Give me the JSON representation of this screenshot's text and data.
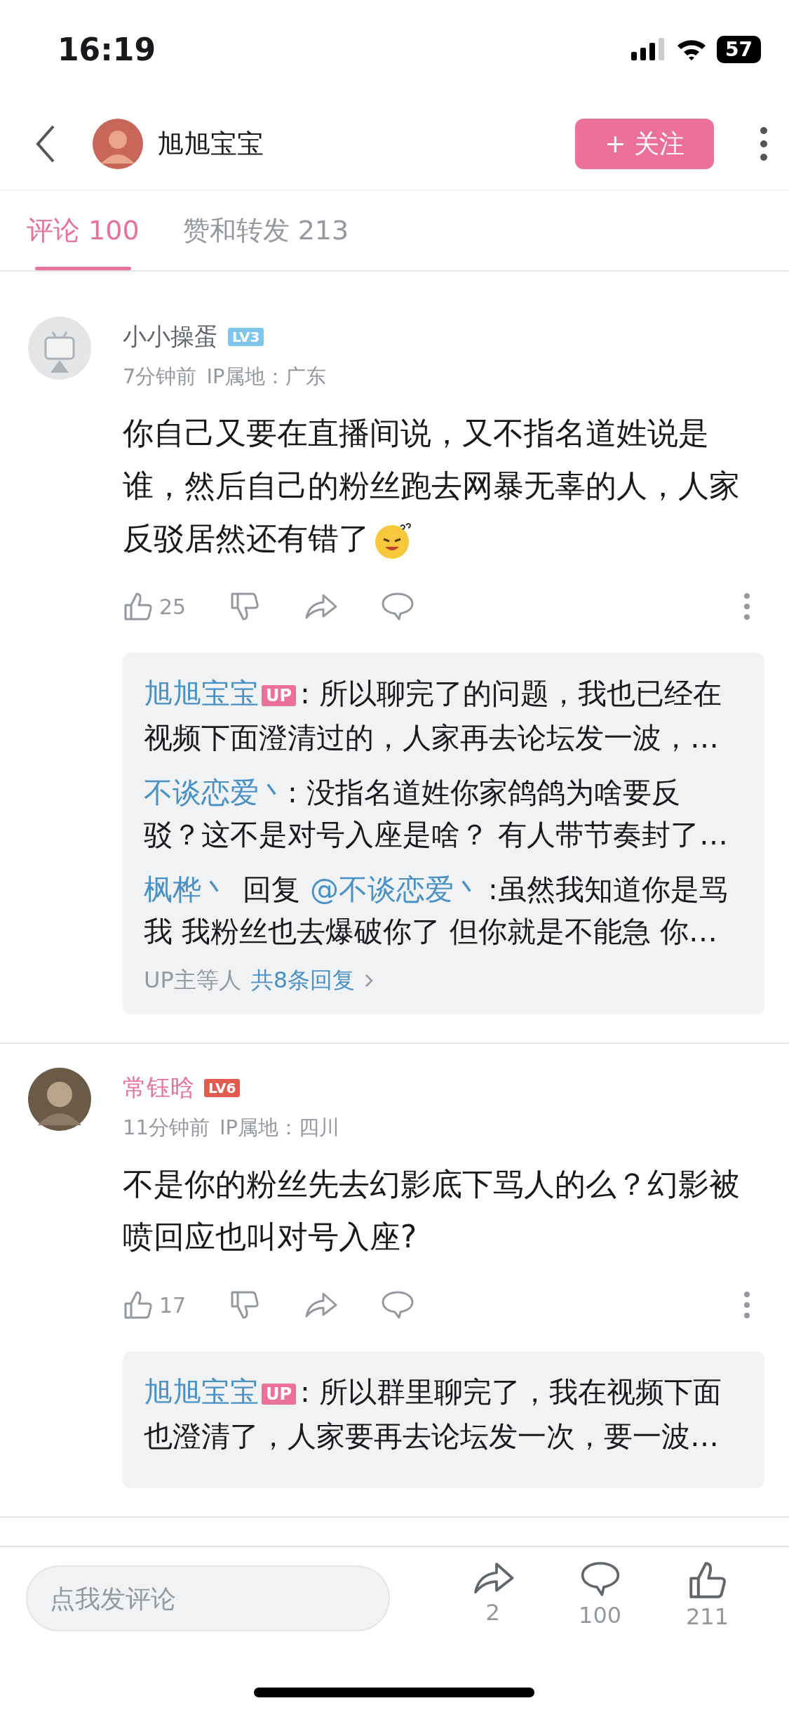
{
  "status_bar": {
    "time": "16:19",
    "battery": "57"
  },
  "header": {
    "user": "旭旭宝宝",
    "follow_button": "+ 关注"
  },
  "tabs": [
    {
      "label": "评论 100",
      "selected": true
    },
    {
      "label": "赞和转发 213",
      "selected": false
    }
  ],
  "comments": [
    {
      "user": "小小操蛋",
      "vip": false,
      "level": "LV3",
      "color": "#7fc6ec",
      "time": "7分钟前",
      "ip": "IP属地：广东",
      "body": "你自己又要在直播间说，又不指名道姓说是谁，然后自己的粉丝跑去网暴无辜的人，人家反驳居然还有错了",
      "emoji": true,
      "likes": "25",
      "replies": [
        {
          "author": "旭旭宝宝",
          "badge": "UP",
          "text": ": 所以聊完了的问题，我也已经在视频下面澄清过的，人家再去论坛发一波，…"
        },
        {
          "author": "不谈恋爱丶",
          "text": ": 没指名道姓你家鸽鸽为啥要反驳？这不是对号入座是啥？ 有人带节奏封了…"
        },
        {
          "author": "枫桦丶",
          "reply_word": "回复",
          "reply_to": "@不谈恋爱丶",
          "text": ":虽然我知道你是骂我 我粉丝也去爆破你了 但你就是不能急 你…"
        }
      ],
      "more": {
        "who": "UP主等人",
        "count": "共8条回复"
      }
    },
    {
      "user": "常钰晗",
      "vip": true,
      "level": "LV6",
      "color": "#e15b4e",
      "time": "11分钟前",
      "ip": "IP属地：四川",
      "body": "不是你的粉丝先去幻影底下骂人的么？幻影被喷回应也叫对号入座?",
      "emoji": false,
      "likes": "17",
      "replies": [
        {
          "author": "旭旭宝宝",
          "badge": "UP",
          "text": ": 所以群里聊完了，我在视频下面也澄清了，人家要再去论坛发一次，要一波…"
        }
      ]
    }
  ],
  "bottom_bar": {
    "placeholder": "点我发评论",
    "shares": "2",
    "comments": "100",
    "likes": "211"
  }
}
